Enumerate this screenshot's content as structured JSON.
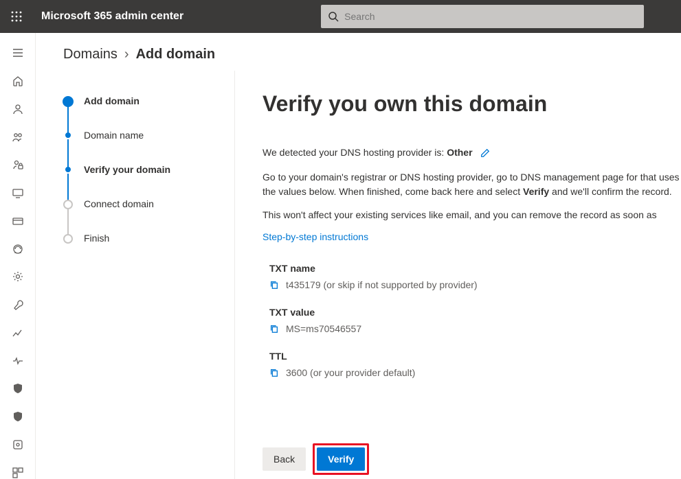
{
  "topbar": {
    "title": "Microsoft 365 admin center",
    "search_placeholder": "Search"
  },
  "breadcrumb": {
    "root": "Domains",
    "current": "Add domain"
  },
  "stepper": {
    "root": "Add domain",
    "steps": [
      "Domain name",
      "Verify your domain",
      "Connect domain",
      "Finish"
    ]
  },
  "panel": {
    "heading": "Verify you own this domain",
    "detect_prefix": "We detected your DNS hosting provider is: ",
    "detect_provider": "Other",
    "body1_a": "Go to your domain's registrar or DNS hosting provider, go to DNS management page for ",
    "body1_b": "that uses the values below. When finished, come back here and select ",
    "body1_bold": "Verify",
    "body1_c": " and we'll confirm the record.",
    "body2": "This won't affect your existing services like email, and you can remove the record as soon as",
    "link": "Step-by-step instructions",
    "records": [
      {
        "label": "TXT name",
        "value": "t435179 (or skip if not supported by provider)"
      },
      {
        "label": "TXT value",
        "value": "MS=ms70546557"
      },
      {
        "label": "TTL",
        "value": "3600 (or your provider default)"
      }
    ]
  },
  "actions": {
    "back": "Back",
    "verify": "Verify"
  }
}
